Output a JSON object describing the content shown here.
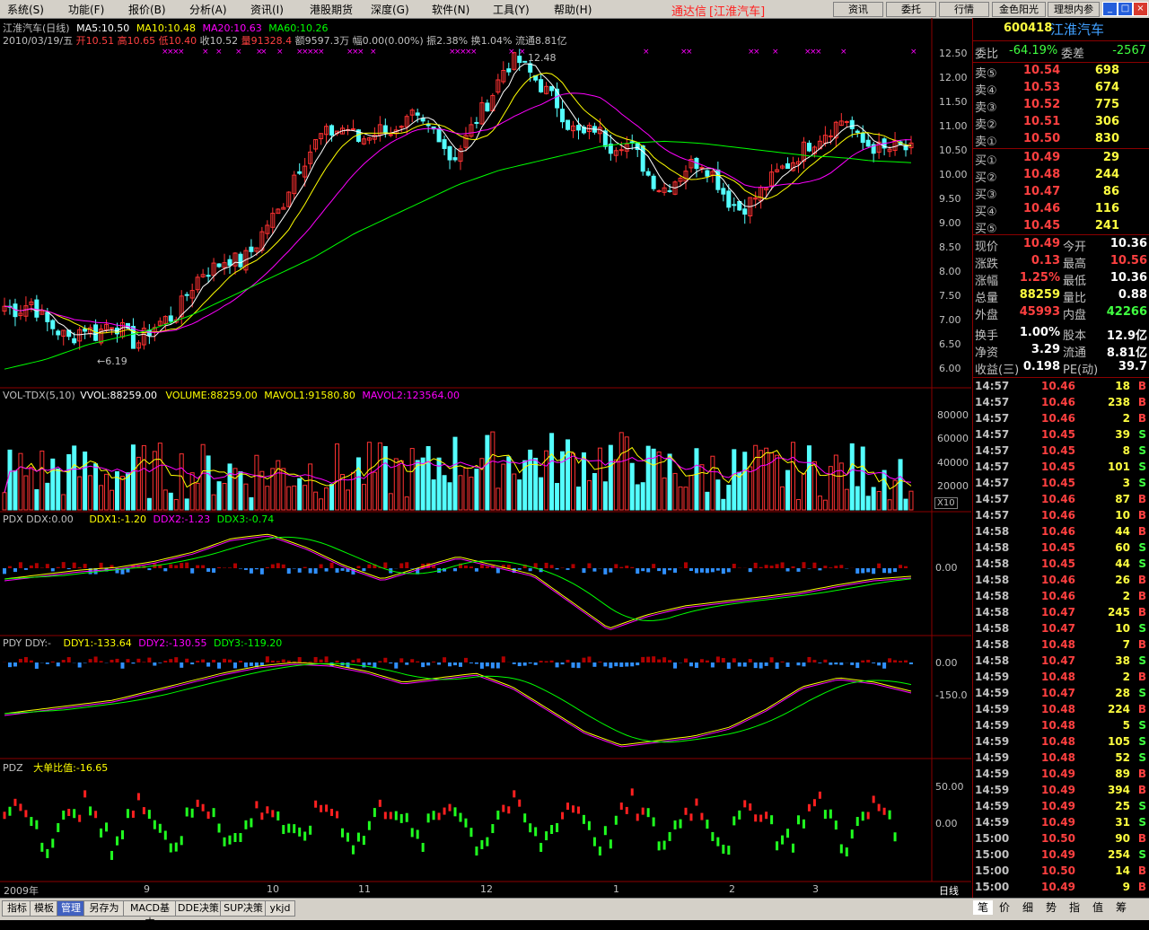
{
  "menu": [
    "系统(S)",
    "功能(F)",
    "报价(B)",
    "分析(A)",
    "资讯(I)",
    "港股期货",
    "深度(G)",
    "软件(N)",
    "工具(Y)",
    "帮助(H)"
  ],
  "app_brand": "通达信",
  "app_stock_tag": "[江淮汽车]",
  "toolbar_buttons": [
    "资讯",
    "委托",
    "行情",
    "金色阳光",
    "理想内参"
  ],
  "window_buttons": [
    "_",
    "□",
    "×"
  ],
  "header": {
    "name": "江淮汽车(日线)",
    "ma5": "MA5:10.50",
    "ma10": "MA10:10.48",
    "ma20": "MA20:10.63",
    "ma60": "MA60:10.26",
    "line2_date": "2010/03/19/五",
    "line2_open": "开10.51",
    "line2_high": "高10.65",
    "line2_low": "低10.40",
    "line2_close": "收10.52",
    "line2_vol": "量91328.4",
    "line2_amt": "额9597.3万",
    "line2_rest": "幅0.00(0.00%) 振2.38% 换1.04% 流通8.81亿"
  },
  "price_axis": [
    "12.50",
    "12.00",
    "11.50",
    "11.00",
    "10.50",
    "10.00",
    "9.50",
    "9.00",
    "8.50",
    "8.00",
    "7.50",
    "7.00",
    "6.50",
    "6.00"
  ],
  "price_annot_high": "12.48",
  "price_annot_low": "←6.19",
  "vol_header": {
    "a": "VOL-TDX(5,10)",
    "b": "VVOL:88259.00",
    "c": "VOLUME:88259.00",
    "d": "MAVOL1:91580.80",
    "e": "MAVOL2:123564.00"
  },
  "vol_axis": [
    "80000",
    "60000",
    "40000",
    "20000"
  ],
  "vol_unit": "X10",
  "pdx_header": {
    "a": "PDX DDX:0.00",
    "b": "DDX1:-1.20",
    "c": "DDX2:-1.23",
    "d": "DDX3:-0.74"
  },
  "pdx_axis": [
    "0.00"
  ],
  "pdy_header": {
    "a": "PDY DDY:-",
    "b": "DDY1:-133.64",
    "c": "DDY2:-130.55",
    "d": "DDY3:-119.20"
  },
  "pdy_axis": [
    "0.00",
    "-150.0"
  ],
  "pdz_header": {
    "a": "PDZ",
    "b": "大单比值:-16.65"
  },
  "pdz_axis": [
    "50.00",
    "0.00"
  ],
  "time_axis": [
    "2009年",
    "9",
    "10",
    "11",
    "12",
    "1",
    "2",
    "3"
  ],
  "period_label": "日线",
  "bottom_tabs": [
    "指标",
    "模板",
    "管理",
    "另存为",
    "MACD基本",
    "DDE决策",
    "SUP决策",
    "ykjd"
  ],
  "right_tabs": [
    "笔",
    "价",
    "细",
    "势",
    "指",
    "值",
    "筹"
  ],
  "quote": {
    "code": "600418",
    "name": "江淮汽车",
    "weibi_label": "委比",
    "weibi": "-64.19%",
    "weicha_label": "委差",
    "weicha": "-2567",
    "sells": [
      {
        "label": "卖⑤",
        "price": "10.54",
        "vol": "698"
      },
      {
        "label": "卖④",
        "price": "10.53",
        "vol": "674"
      },
      {
        "label": "卖③",
        "price": "10.52",
        "vol": "775"
      },
      {
        "label": "卖②",
        "price": "10.51",
        "vol": "306"
      },
      {
        "label": "卖①",
        "price": "10.50",
        "vol": "830"
      }
    ],
    "buys": [
      {
        "label": "买①",
        "price": "10.49",
        "vol": "29"
      },
      {
        "label": "买②",
        "price": "10.48",
        "vol": "244"
      },
      {
        "label": "买③",
        "price": "10.47",
        "vol": "86"
      },
      {
        "label": "买④",
        "price": "10.46",
        "vol": "116"
      },
      {
        "label": "买⑤",
        "price": "10.45",
        "vol": "241"
      }
    ],
    "stats": [
      {
        "l1": "现价",
        "v1": "10.49",
        "c1": "#ff4040",
        "l2": "今开",
        "v2": "10.36",
        "c2": "#ffffff"
      },
      {
        "l1": "涨跌",
        "v1": "0.13",
        "c1": "#ff4040",
        "l2": "最高",
        "v2": "10.56",
        "c2": "#ff4040"
      },
      {
        "l1": "涨幅",
        "v1": "1.25%",
        "c1": "#ff4040",
        "l2": "最低",
        "v2": "10.36",
        "c2": "#ffffff"
      },
      {
        "l1": "总量",
        "v1": "88259",
        "c1": "#ffff40",
        "l2": "量比",
        "v2": "0.88",
        "c2": "#ffffff"
      },
      {
        "l1": "外盘",
        "v1": "45993",
        "c1": "#ff4040",
        "l2": "内盘",
        "v2": "42266",
        "c2": "#40ff40"
      },
      {
        "l1": "换手",
        "v1": "1.00%",
        "c1": "#ffffff",
        "l2": "股本",
        "v2": "12.9亿",
        "c2": "#ffffff"
      },
      {
        "l1": "净资",
        "v1": "3.29",
        "c1": "#ffffff",
        "l2": "流通",
        "v2": "8.81亿",
        "c2": "#ffffff"
      },
      {
        "l1": "收益(三)",
        "v1": "0.198",
        "c1": "#ffffff",
        "l2": "PE(动)",
        "v2": "39.7",
        "c2": "#ffffff"
      }
    ],
    "ticks": [
      [
        "14:57",
        "10.46",
        "18",
        "B"
      ],
      [
        "14:57",
        "10.46",
        "238",
        "B"
      ],
      [
        "14:57",
        "10.46",
        "2",
        "B"
      ],
      [
        "14:57",
        "10.45",
        "39",
        "S"
      ],
      [
        "14:57",
        "10.45",
        "8",
        "S"
      ],
      [
        "14:57",
        "10.45",
        "101",
        "S"
      ],
      [
        "14:57",
        "10.45",
        "3",
        "S"
      ],
      [
        "14:57",
        "10.46",
        "87",
        "B"
      ],
      [
        "14:57",
        "10.46",
        "10",
        "B"
      ],
      [
        "14:58",
        "10.46",
        "44",
        "B"
      ],
      [
        "14:58",
        "10.45",
        "60",
        "S"
      ],
      [
        "14:58",
        "10.45",
        "44",
        "S"
      ],
      [
        "14:58",
        "10.46",
        "26",
        "B"
      ],
      [
        "14:58",
        "10.46",
        "2",
        "B"
      ],
      [
        "14:58",
        "10.47",
        "245",
        "B"
      ],
      [
        "14:58",
        "10.47",
        "10",
        "S"
      ],
      [
        "14:58",
        "10.48",
        "7",
        "B"
      ],
      [
        "14:58",
        "10.47",
        "38",
        "S"
      ],
      [
        "14:59",
        "10.48",
        "2",
        "B"
      ],
      [
        "14:59",
        "10.47",
        "28",
        "S"
      ],
      [
        "14:59",
        "10.48",
        "224",
        "B"
      ],
      [
        "14:59",
        "10.48",
        "5",
        "S"
      ],
      [
        "14:59",
        "10.48",
        "105",
        "S"
      ],
      [
        "14:59",
        "10.48",
        "52",
        "S"
      ],
      [
        "14:59",
        "10.49",
        "89",
        "B"
      ],
      [
        "14:59",
        "10.49",
        "394",
        "B"
      ],
      [
        "14:59",
        "10.49",
        "25",
        "S"
      ],
      [
        "14:59",
        "10.49",
        "31",
        "S"
      ],
      [
        "15:00",
        "10.50",
        "90",
        "B"
      ],
      [
        "15:00",
        "10.49",
        "254",
        "S"
      ],
      [
        "15:00",
        "10.50",
        "14",
        "B"
      ],
      [
        "15:00",
        "10.49",
        "9",
        "B"
      ]
    ]
  },
  "chart_data": {
    "type": "candlestick",
    "periods": [
      "2009年",
      "9",
      "10",
      "11",
      "12",
      "1",
      "2",
      "3"
    ],
    "price_range": [
      5.8,
      12.8
    ],
    "high": 12.48,
    "low": 6.19,
    "close_path": [
      7.3,
      7.2,
      7.4,
      7.0,
      6.8,
      6.6,
      6.9,
      6.7,
      7.0,
      6.8,
      6.5,
      6.8,
      7.0,
      7.1,
      7.6,
      8.0,
      8.1,
      8.3,
      8.2,
      8.5,
      9.0,
      9.3,
      10.0,
      10.4,
      10.8,
      10.9,
      11.0,
      10.7,
      10.9,
      11.0,
      10.8,
      11.2,
      11.0,
      10.9,
      10.3,
      10.7,
      11.2,
      11.6,
      12.2,
      12.4,
      12.1,
      11.8,
      11.5,
      11.0,
      10.8,
      11.0,
      10.6,
      10.7,
      10.5,
      10.0,
      9.7,
      9.9,
      10.2,
      10.3,
      10.0,
      9.5,
      9.3,
      9.5,
      9.8,
      10.1,
      10.3,
      10.6,
      10.8,
      11.0,
      11.2,
      10.7,
      10.6,
      10.5,
      10.6,
      10.5
    ],
    "ma60_path": [
      6.0,
      6.1,
      6.2,
      6.35,
      6.5,
      6.6,
      6.7,
      6.8,
      6.95,
      7.1,
      7.3,
      7.5,
      7.7,
      7.9,
      8.1,
      8.3,
      8.55,
      8.8,
      9.0,
      9.2,
      9.4,
      9.6,
      9.8,
      9.95,
      10.1,
      10.2,
      10.3,
      10.4,
      10.5,
      10.6,
      10.65,
      10.68,
      10.7,
      10.68,
      10.65,
      10.6,
      10.55,
      10.5,
      10.45,
      10.4,
      10.38,
      10.35,
      10.3,
      10.28,
      10.26
    ],
    "volume_range": [
      0,
      90000
    ],
    "volume_last": 88259,
    "ddx": {
      "DDX": 0.0,
      "DDX1": -1.2,
      "DDX2": -1.23,
      "DDX3": -0.74
    },
    "ddy": {
      "DDY1": -133.64,
      "DDY2": -130.55,
      "DDY3": -119.2
    },
    "pdz": {
      "大单比值": -16.65
    }
  }
}
